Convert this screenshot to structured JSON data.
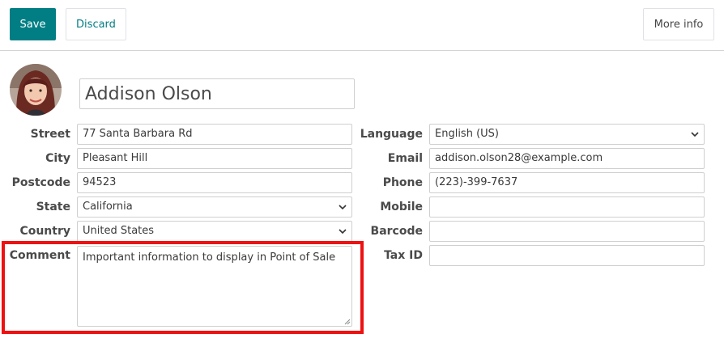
{
  "toolbar": {
    "save_label": "Save",
    "discard_label": "Discard",
    "more_info_label": "More info"
  },
  "contact": {
    "name": "Addison Olson"
  },
  "left_fields": {
    "street": {
      "label": "Street",
      "value": "77 Santa Barbara Rd"
    },
    "city": {
      "label": "City",
      "value": "Pleasant Hill"
    },
    "postcode": {
      "label": "Postcode",
      "value": "94523"
    },
    "state": {
      "label": "State",
      "value": "California"
    },
    "country": {
      "label": "Country",
      "value": "United States"
    },
    "comment": {
      "label": "Comment",
      "value": "Important information to display in Point of Sale"
    }
  },
  "right_fields": {
    "language": {
      "label": "Language",
      "value": "English (US)"
    },
    "email": {
      "label": "Email",
      "value": "addison.olson28@example.com"
    },
    "phone": {
      "label": "Phone",
      "value": "(223)-399-7637"
    },
    "mobile": {
      "label": "Mobile",
      "value": ""
    },
    "barcode": {
      "label": "Barcode",
      "value": ""
    },
    "tax_id": {
      "label": "Tax ID",
      "value": ""
    }
  },
  "colors": {
    "primary": "#017e84",
    "highlight": "#ee1111"
  }
}
